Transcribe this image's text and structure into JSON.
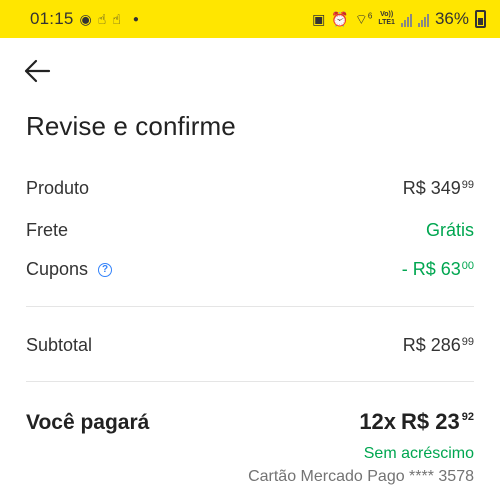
{
  "status_bar": {
    "time": "01:15",
    "battery": "36%",
    "network": "LTE1",
    "volte": "Vo))",
    "wifi_badge": "6"
  },
  "header": {
    "back_icon": "arrow-left-icon",
    "title": "Revise e confirme"
  },
  "summary": {
    "produto": {
      "label": "Produto",
      "integer": "R$ 349",
      "cents": "99"
    },
    "frete": {
      "label": "Frete",
      "value": "Grátis"
    },
    "cupons": {
      "label": "Cupons",
      "help_icon": "question-circle-icon",
      "integer": "- R$ 63",
      "cents": "00"
    },
    "subtotal": {
      "label": "Subtotal",
      "integer": "R$ 286",
      "cents": "99"
    }
  },
  "total": {
    "label": "Você pagará",
    "installments": "12x",
    "integer": "R$ 23",
    "cents": "92",
    "no_interest": "Sem acréscimo",
    "payment_method": "Cartão Mercado Pago **** 3578"
  },
  "colors": {
    "brand_yellow": "#ffe600",
    "green": "#00a650",
    "blue": "#3483fa",
    "text": "#222222",
    "muted": "#737373"
  }
}
